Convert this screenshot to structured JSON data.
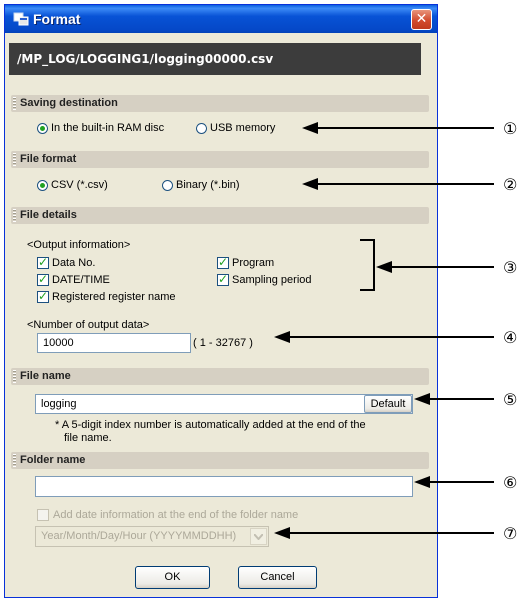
{
  "window": {
    "title": "Format",
    "close_glyph": "✕",
    "path": "/MP_LOG/LOGGING1/logging00000.csv"
  },
  "saving_destination": {
    "header": "Saving destination",
    "options": [
      "In the built-in RAM disc",
      "USB memory"
    ],
    "selected": "In the built-in RAM disc"
  },
  "file_format": {
    "header": "File format",
    "options": [
      "CSV (*.csv)",
      "Binary (*.bin)"
    ],
    "selected": "CSV (*.csv)"
  },
  "file_details": {
    "header": "File details",
    "output_info_label": "<Output information>",
    "checkboxes": [
      {
        "label": "Data No.",
        "checked": true
      },
      {
        "label": "Program",
        "checked": true
      },
      {
        "label": "DATE/TIME",
        "checked": true
      },
      {
        "label": "Sampling period",
        "checked": true
      },
      {
        "label": "Registered register name",
        "checked": true
      }
    ],
    "output_count_label": "<Number of output data>",
    "output_count_value": "10000",
    "output_count_range": "( 1 - 32767 )"
  },
  "file_name": {
    "header": "File name",
    "value": "logging",
    "default_button": "Default",
    "note_line1": "* A 5-digit index number is automatically added at the end of the",
    "note_line2": "file name."
  },
  "folder_name": {
    "header": "Folder name",
    "value": "",
    "add_date_label": "Add date information at the end of the folder name",
    "add_date_checked": false,
    "date_format": "Year/Month/Day/Hour (YYYYMMDDHH)"
  },
  "buttons": {
    "ok": "OK",
    "cancel": "Cancel"
  },
  "callouts": [
    "①",
    "②",
    "③",
    "④",
    "⑤",
    "⑥",
    "⑦"
  ],
  "icons": [
    "window-icon",
    "close-icon",
    "chevron-down-icon",
    "arrow-left-icon"
  ],
  "colors": {
    "titlebar": "#0853d6",
    "dialog_bg": "#ece9d8",
    "path_bg": "#3c3c3c",
    "check_green": "#21a121",
    "close_red": "#d24b2d"
  }
}
